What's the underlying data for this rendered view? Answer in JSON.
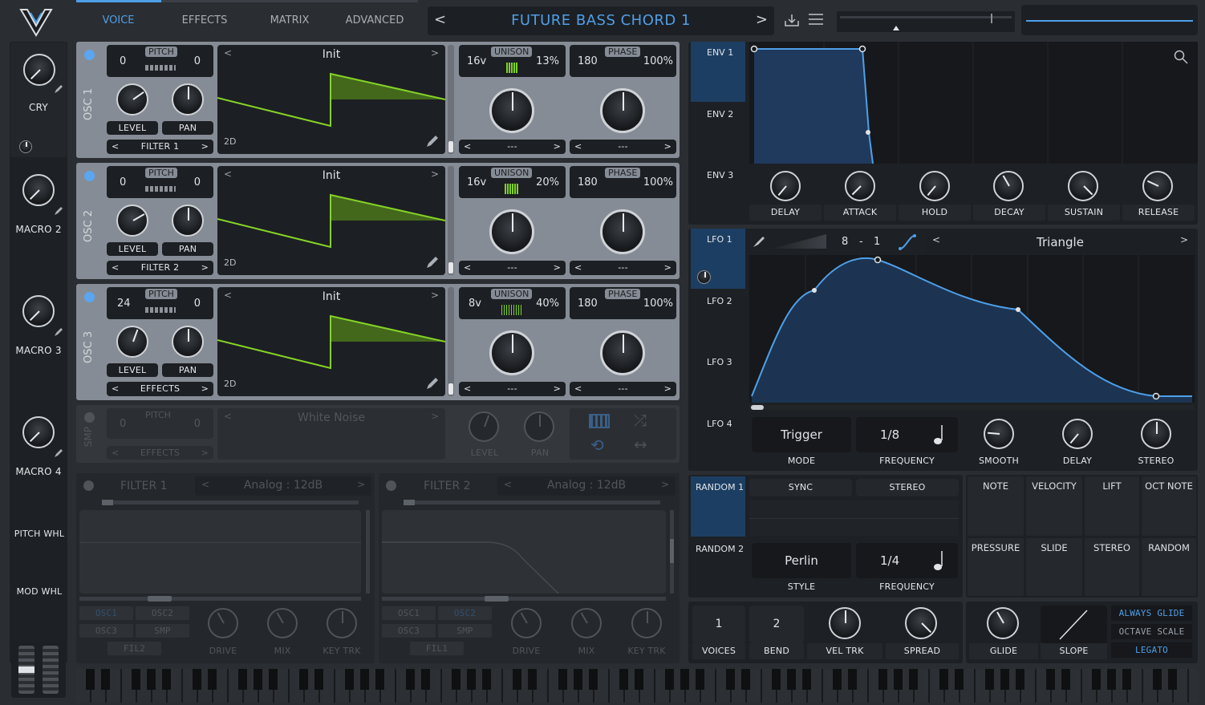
{
  "header": {
    "tabs": [
      "VOICE",
      "EFFECTS",
      "MATRIX",
      "ADVANCED"
    ],
    "preset_name": "FUTURE BASS CHORD 1",
    "prev": "<",
    "next": ">"
  },
  "macros": [
    {
      "label": "CRY"
    },
    {
      "label": "MACRO 2"
    },
    {
      "label": "MACRO 3"
    },
    {
      "label": "MACRO 4"
    }
  ],
  "wheels": [
    "PITCH WHL",
    "MOD WHL"
  ],
  "oscillators": [
    {
      "label": "OSC 1",
      "pitch_left": "0",
      "pitch_right": "0",
      "wave": "Init",
      "unison_voices": "16v",
      "unison_pct": "13%",
      "phase": "180",
      "phase_pct": "100%",
      "route": "FILTER 1",
      "dim": "2D"
    },
    {
      "label": "OSC 2",
      "pitch_left": "0",
      "pitch_right": "0",
      "wave": "Init",
      "unison_voices": "16v",
      "unison_pct": "20%",
      "phase": "180",
      "phase_pct": "100%",
      "route": "FILTER 2",
      "dim": "2D"
    },
    {
      "label": "OSC 3",
      "pitch_left": "24",
      "pitch_right": "0",
      "wave": "Init",
      "unison_voices": "8v",
      "unison_pct": "40%",
      "phase": "180",
      "phase_pct": "100%",
      "route": "EFFECTS",
      "dim": "2D"
    }
  ],
  "common": {
    "pitch": "PITCH",
    "level": "LEVEL",
    "pan": "PAN",
    "unison": "UNISON",
    "phase": "PHASE",
    "none": "---"
  },
  "sampler": {
    "label": "SMP",
    "pitch": "PITCH",
    "pitch_left": "0",
    "pitch_right": "0",
    "sample": "White Noise",
    "route": "EFFECTS",
    "level": "LEVEL",
    "pan": "PAN"
  },
  "filters": [
    {
      "label": "FILTER 1",
      "type": "Analog : 12dB",
      "src": [
        "OSC1",
        "OSC2",
        "OSC3",
        "SMP"
      ],
      "fil": "FIL2",
      "drive": "DRIVE",
      "mix": "MIX",
      "keytrk": "KEY TRK"
    },
    {
      "label": "FILTER 2",
      "type": "Analog : 12dB",
      "src": [
        "OSC1",
        "OSC2",
        "OSC3",
        "SMP"
      ],
      "fil": "FIL1",
      "drive": "DRIVE",
      "mix": "MIX",
      "keytrk": "KEY TRK"
    }
  ],
  "env": {
    "tabs": [
      "ENV 1",
      "ENV 2",
      "ENV 3"
    ],
    "knobs": [
      "DELAY",
      "ATTACK",
      "HOLD",
      "DECAY",
      "SUSTAIN",
      "RELEASE"
    ]
  },
  "lfo": {
    "tabs": [
      "LFO 1",
      "LFO 2",
      "LFO 3",
      "LFO 4"
    ],
    "grid_a": "8",
    "grid_sep": "-",
    "grid_b": "1",
    "shape": "Triangle",
    "mode_value": "Trigger",
    "mode": "MODE",
    "freq_value": "1/8",
    "freq": "FREQUENCY",
    "smooth": "SMOOTH",
    "delay": "DELAY",
    "stereo": "STEREO"
  },
  "random": {
    "tabs": [
      "RANDOM 1",
      "RANDOM 2"
    ],
    "sync": "SYNC",
    "stereo": "STEREO",
    "style_value": "Perlin",
    "style": "STYLE",
    "freq_value": "1/4",
    "freq": "FREQUENCY"
  },
  "mod_sources": [
    "NOTE",
    "VELOCITY",
    "LIFT",
    "OCT NOTE",
    "PRESSURE",
    "SLIDE",
    "STEREO",
    "RANDOM"
  ],
  "voice": {
    "voices_value": "1",
    "voices": "VOICES",
    "bend_value": "2",
    "bend": "BEND",
    "veltrk": "VEL TRK",
    "spread": "SPREAD",
    "glide": "GLIDE",
    "slope": "SLOPE",
    "opts": [
      "ALWAYS GLIDE",
      "OCTAVE SCALE",
      "LEGATO"
    ]
  },
  "colors": {
    "accent": "#4f9fe8",
    "osc_panel": "#868c95",
    "wave_green": "#7ed321",
    "env_blue": "#3f8fe0"
  }
}
